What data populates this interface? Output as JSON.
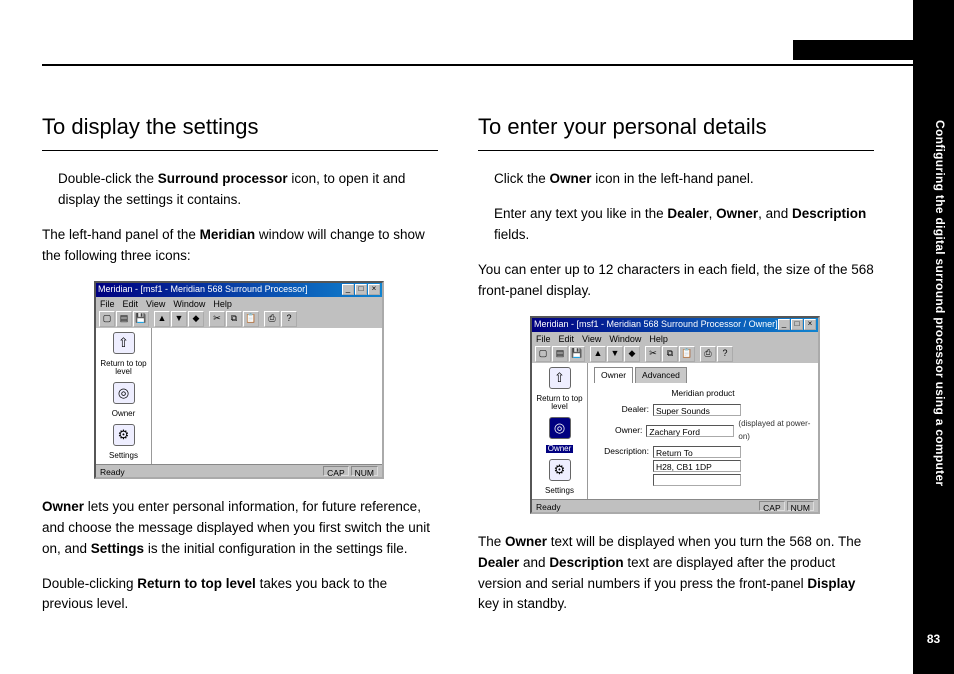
{
  "section_label": "Configuring the digital surround processor using a computer",
  "page_number": "83",
  "left": {
    "heading": "To display the settings",
    "p1a": "Double-click the ",
    "p1b": "Surround processor",
    "p1c": " icon, to open it and display the settings it contains.",
    "p2a": "The left-hand panel of the ",
    "p2b": "Meridian",
    "p2c": " window will change to show the following three icons:",
    "p3a": "Owner",
    "p3b": " lets you enter personal information, for future reference, and choose the message displayed when you first switch the unit on, and ",
    "p3c": "Settings",
    "p3d": " is the initial configuration in the settings file.",
    "p4a": "Double-clicking ",
    "p4b": "Return to top level",
    "p4c": " takes you back to the previous level."
  },
  "right": {
    "heading": "To enter your personal details",
    "p1a": "Click the ",
    "p1b": "Owner",
    "p1c": " icon in the left-hand panel.",
    "p2a": "Enter any text you like in the ",
    "p2b": "Dealer",
    "p2c": ", ",
    "p2d": "Owner",
    "p2e": ", and ",
    "p2f": "Description",
    "p2g": " fields.",
    "p3": "You can enter up to 12 characters in each field, the size of the 568 front-panel display.",
    "p4a": "The ",
    "p4b": "Owner",
    "p4c": " text will be displayed when you turn the 568 on. The ",
    "p4d": "Dealer",
    "p4e": " and ",
    "p4f": "Description",
    "p4g": " text are displayed after the product version and serial numbers if you press the front-panel ",
    "p4h": "Display",
    "p4i": " key in standby."
  },
  "shot1": {
    "title": "Meridian - [msf1 - Meridian 568 Surround Processor]",
    "menus": [
      "File",
      "Edit",
      "View",
      "Window",
      "Help"
    ],
    "icons": {
      "return": "Return to top level",
      "owner": "Owner",
      "settings": "Settings"
    },
    "status_ready": "Ready",
    "status_ind": [
      "CAP",
      "NUM"
    ]
  },
  "shot2": {
    "title": "Meridian - [msf1 - Meridian 568 Surround Processor / Owner]",
    "menus": [
      "File",
      "Edit",
      "View",
      "Window",
      "Help"
    ],
    "icons": {
      "return": "Return to top level",
      "owner": "Owner",
      "settings": "Settings"
    },
    "tabs": [
      "Owner",
      "Advanced"
    ],
    "group_label": "Meridian product",
    "fields": {
      "dealer_label": "Dealer:",
      "dealer_value": "Super Sounds",
      "owner_label": "Owner:",
      "owner_value": "Zachary Ford",
      "owner_note": "(displayed at power-on)",
      "desc_label": "Description:",
      "desc_value1": "Return To",
      "desc_value2": "H28, CB1 1DP"
    },
    "status_ready": "Ready",
    "status_ind": [
      "CAP",
      "NUM"
    ]
  }
}
